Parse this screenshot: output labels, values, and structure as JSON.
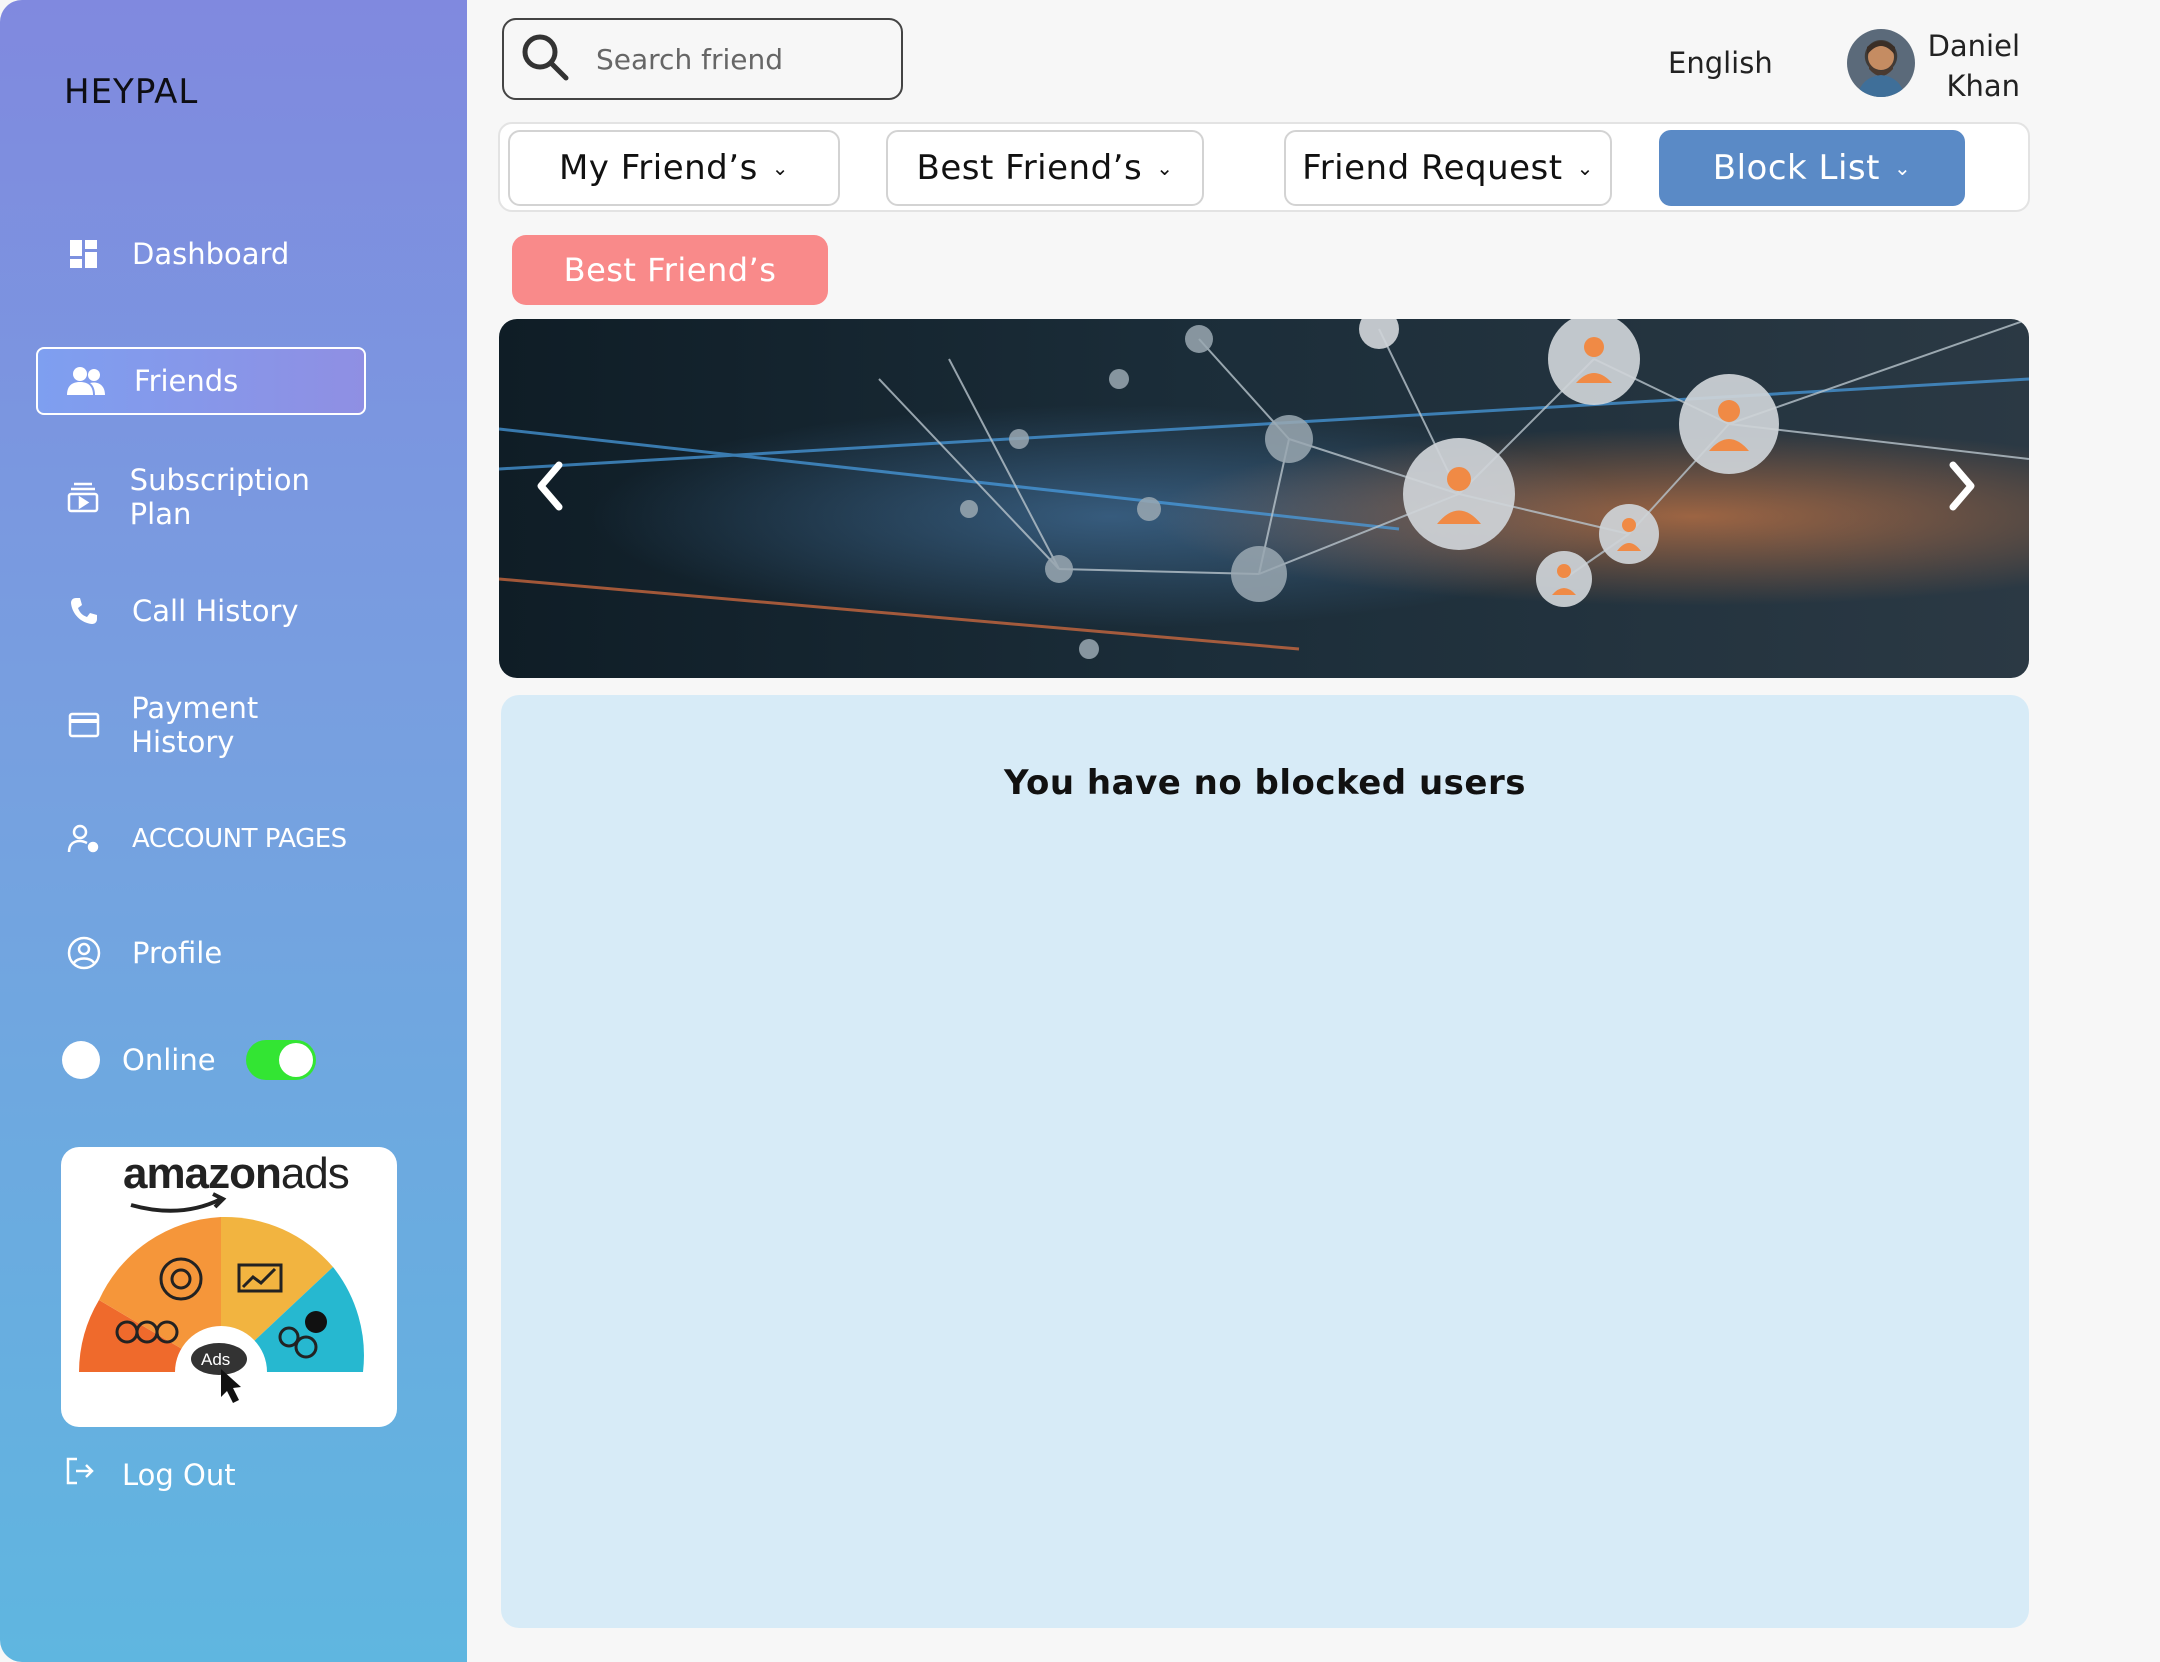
{
  "brand": "HEYPAL",
  "sidebar": {
    "items": [
      {
        "label": "Dashboard",
        "icon": "dashboard-icon"
      },
      {
        "label": "Friends",
        "icon": "users-icon",
        "active": true
      },
      {
        "label": "Subscription Plan",
        "icon": "subscription-icon"
      },
      {
        "label": "Call History",
        "icon": "phone-icon"
      },
      {
        "label": "Payment History",
        "icon": "credit-card-icon"
      },
      {
        "label": "ACCOUNT PAGES",
        "icon": "account-settings-icon"
      },
      {
        "label": "Profile",
        "icon": "profile-icon"
      }
    ],
    "online_label": "Online",
    "online_enabled": true,
    "logout_label": "Log Out"
  },
  "ad": {
    "brand_bold": "amazon",
    "brand_light": "ads",
    "badge": "Ads"
  },
  "search": {
    "placeholder": "Search friend"
  },
  "header": {
    "language": "English",
    "user_first": "Daniel",
    "user_last": "Khan"
  },
  "tabs": [
    {
      "label": "My Friend’s",
      "active": false
    },
    {
      "label": "Best Friend’s",
      "active": false
    },
    {
      "label": "Friend Request",
      "active": false
    },
    {
      "label": "Block List",
      "active": true
    }
  ],
  "section_pill": "Best Friend’s",
  "content": {
    "empty_message": "You have no blocked users"
  },
  "colors": {
    "sidebar_top": "#8089df",
    "sidebar_bottom": "#5fb6e0",
    "active_tab": "#5a8ac6",
    "pill": "#f98a8a",
    "content_bg": "#d7ebf7",
    "toggle_on": "#33e533"
  }
}
